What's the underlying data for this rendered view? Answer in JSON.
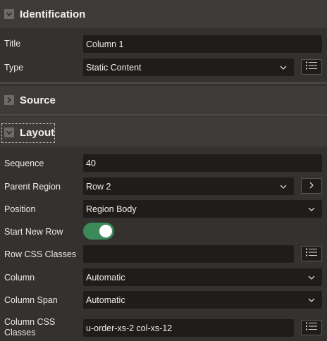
{
  "identification": {
    "header": "Identification",
    "title_label": "Title",
    "title_value": "Column 1",
    "type_label": "Type",
    "type_value": "Static Content"
  },
  "source": {
    "header": "Source"
  },
  "layout": {
    "header": "Layout",
    "sequence_label": "Sequence",
    "sequence_value": "40",
    "parent_region_label": "Parent Region",
    "parent_region_value": "Row 2",
    "position_label": "Position",
    "position_value": "Region Body",
    "start_new_row_label": "Start New Row",
    "start_new_row_on": true,
    "row_css_label": "Row CSS Classes",
    "row_css_value": "",
    "column_label": "Column",
    "column_value": "Automatic",
    "column_span_label": "Column Span",
    "column_span_value": "Automatic",
    "column_css_label_line1": "Column CSS",
    "column_css_label_line2": "Classes",
    "column_css_value": "u-order-xs-2 col-xs-12"
  },
  "colors": {
    "background": "#34312f",
    "section_header": "#3f3b38",
    "field": "#1f1d1c",
    "switch_on": "#3c8a5a"
  },
  "icons": {
    "collapse": "chevron-down-icon",
    "expand": "chevron-right-icon",
    "list": "list-icon",
    "navigate": "chevron-right-icon"
  }
}
